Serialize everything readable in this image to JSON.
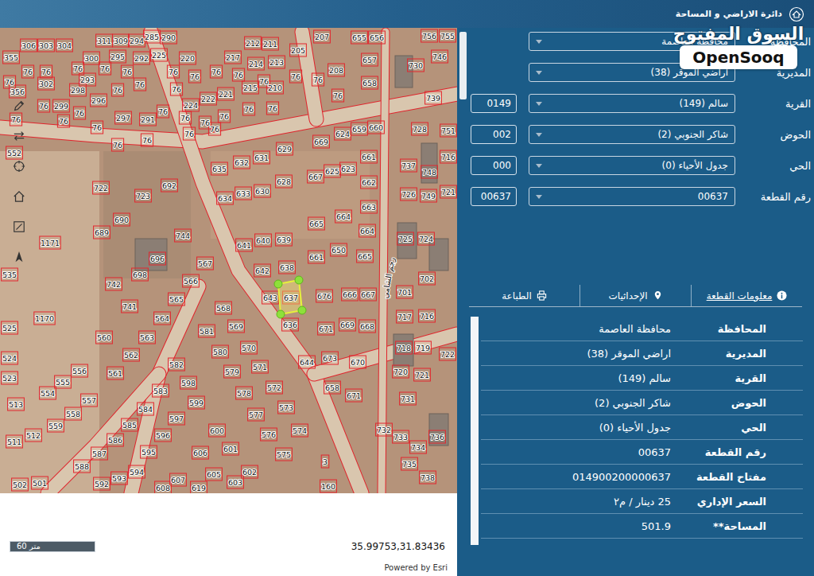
{
  "header": {
    "title": "دائرة الاراضي و المساحة"
  },
  "watermark": {
    "arabic": "السوق المفتوح",
    "latin": "OpenSooq"
  },
  "search_form": {
    "fields": [
      {
        "label": "المحافظة",
        "value": "محافظة العاصمة"
      },
      {
        "label": "المديرية",
        "value": "اراضي الموقر (38)"
      },
      {
        "label": "القرية",
        "value": "سالم (149)",
        "code": "0149"
      },
      {
        "label": "الحوض",
        "value": "شاكر الجنوبي (2)",
        "code": "002"
      },
      {
        "label": "الحي",
        "value": "جدول الأحياء (0)",
        "code": "000"
      },
      {
        "label": "رقم القطعة",
        "value": "00637",
        "code": "00637"
      }
    ]
  },
  "tabs": [
    {
      "label": "معلومات القطعة",
      "kind": "info",
      "selected": true
    },
    {
      "label": "الإحداثيات",
      "kind": "coordinates",
      "selected": false
    },
    {
      "label": "الطباعة",
      "kind": "print",
      "selected": false
    }
  ],
  "details": [
    {
      "label": "المحافظة",
      "value": "محافظة العاصمة"
    },
    {
      "label": "المديرية",
      "value": "اراضي الموقر (38)"
    },
    {
      "label": "القرية",
      "value": "سالم (149)"
    },
    {
      "label": "الحوض",
      "value": "شاكر الجنوبي (2)"
    },
    {
      "label": "الحي",
      "value": "جدول الأحياء (0)"
    },
    {
      "label": "رقم القطعة",
      "value": "00637"
    },
    {
      "label": "مفتاح القطعة",
      "value": "014900200000637"
    },
    {
      "label": "السعر الإداري",
      "value": "25 دينار / م٢"
    },
    {
      "label": "**المساحة",
      "value": "501.9"
    }
  ],
  "map": {
    "parcels": [
      "355",
      "306",
      "303",
      "304",
      "311",
      "309",
      "294",
      "285",
      "290",
      "212",
      "211",
      "207",
      "655",
      "656",
      "756",
      "755",
      "76",
      "76",
      "76",
      "300",
      "76",
      "295",
      "292",
      "225",
      "220",
      "217",
      "205",
      "657",
      "730",
      "746",
      "302",
      "76",
      "76",
      "293",
      "76",
      "76",
      "76",
      "76",
      "214",
      "76",
      "213",
      "76",
      "208",
      "76",
      "658",
      "739",
      "356",
      "298",
      "296",
      "76",
      "215",
      "210",
      "224",
      "222",
      "221",
      "76",
      "76",
      "76",
      "299",
      "76",
      "297",
      "291",
      "76",
      "76",
      "76",
      "76",
      "76",
      "76",
      "76",
      "76",
      "76",
      "76",
      "76",
      "76",
      "76",
      "76",
      "552",
      "722",
      "723",
      "692",
      "690",
      "689",
      "744",
      "696",
      "698",
      "742",
      "741",
      "1171",
      "535",
      "1170",
      "525",
      "524",
      "523",
      "513",
      "511",
      "512",
      "502",
      "501",
      "635",
      "632",
      "631",
      "629",
      "630",
      "633",
      "634",
      "628",
      "669",
      "624",
      "659",
      "660",
      "667",
      "625",
      "623",
      "661",
      "662",
      "663",
      "664",
      "665",
      "664",
      "665",
      "650",
      "661",
      "641",
      "640",
      "639",
      "638",
      "642",
      "643",
      "637",
      "636",
      "676",
      "666",
      "667",
      "671",
      "669",
      "668",
      "673",
      "670",
      "644",
      "658",
      "671",
      "567",
      "566",
      "565",
      "564",
      "563",
      "562",
      "561",
      "560",
      "568",
      "569",
      "581",
      "580",
      "570",
      "571",
      "579",
      "572",
      "578",
      "573",
      "577",
      "576",
      "574",
      "575",
      "582",
      "583",
      "584",
      "585",
      "586",
      "587",
      "588",
      "592",
      "593",
      "594",
      "595",
      "596",
      "597",
      "598",
      "599",
      "600",
      "601",
      "602",
      "603",
      "605",
      "606",
      "607",
      "608",
      "619",
      "3",
      "160",
      "556",
      "555",
      "554",
      "557",
      "558",
      "559",
      "728",
      "751",
      "716",
      "737",
      "748",
      "726",
      "749",
      "721",
      "725",
      "724",
      "702",
      "701",
      "717",
      "716",
      "722",
      "718",
      "719",
      "720",
      "721",
      "731",
      "732",
      "733",
      "736",
      "734",
      "735",
      "738"
    ],
    "selected_parcel": "637",
    "street_label": "رجم الشامي",
    "scale_bar": "60 متر",
    "coordinates": "35.99753,31.83436",
    "attribution": "Powered by Esri"
  }
}
